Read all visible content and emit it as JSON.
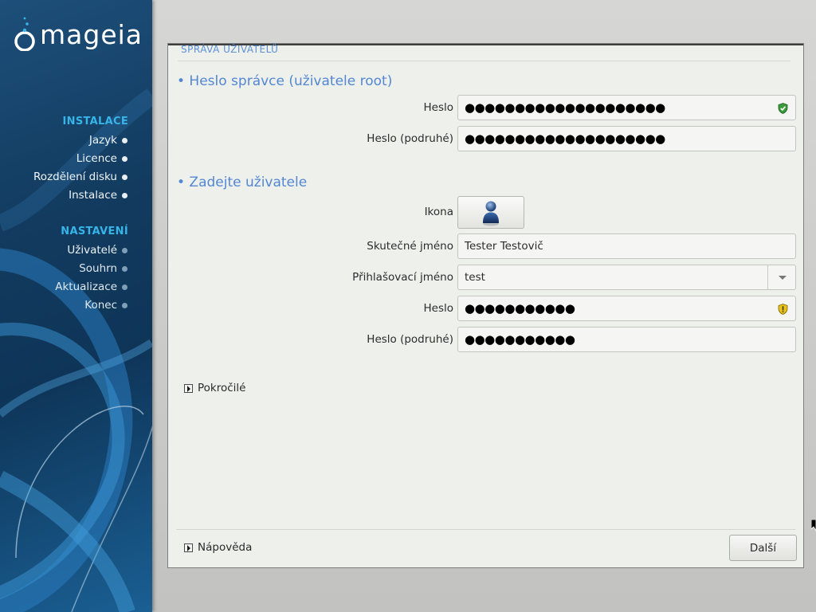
{
  "sidebar": {
    "logo_text": "mageia",
    "sections": [
      {
        "title": "INSTALACE",
        "steps": [
          {
            "label": "Jazyk",
            "state": "done"
          },
          {
            "label": "Licence",
            "state": "done"
          },
          {
            "label": "Rozdělení disku",
            "state": "done"
          },
          {
            "label": "Instalace",
            "state": "done"
          }
        ]
      },
      {
        "title": "NASTAVENÍ",
        "steps": [
          {
            "label": "Uživatelé",
            "state": "current"
          },
          {
            "label": "Souhrn",
            "state": "pending"
          },
          {
            "label": "Aktualizace",
            "state": "pending"
          },
          {
            "label": "Konec",
            "state": "pending"
          }
        ]
      }
    ]
  },
  "panel": {
    "title": "SPRÁVA UŽIVATELŮ",
    "root_group": {
      "title": "• Heslo správce (uživatele root)",
      "password_label": "Heslo",
      "password_value": "●●●●●●●●●●●●●●●●●●●●",
      "password_strength_icon": "shield-green-check-icon",
      "password2_label": "Heslo (podruhé)",
      "password2_value": "●●●●●●●●●●●●●●●●●●●●"
    },
    "user_group": {
      "title": "• Zadejte uživatele",
      "icon_label": "Ikona",
      "icon_name": "user-avatar-icon",
      "realname_label": "Skutečné jméno",
      "realname_value": "Tester Testovič",
      "login_label": "Přihlašovací jméno",
      "login_value": "test",
      "password_label": "Heslo",
      "password_value": "●●●●●●●●●●●",
      "password_strength_icon": "shield-yellow-warning-icon",
      "password2_label": "Heslo (podruhé)",
      "password2_value": "●●●●●●●●●●●"
    },
    "advanced_label": "Pokročilé",
    "help_label": "Nápověda",
    "next_label": "Další"
  },
  "colors": {
    "accent_blue": "#5387d3",
    "sidebar_heading": "#37b4e8",
    "sidebar_bg": "#123b5f"
  }
}
